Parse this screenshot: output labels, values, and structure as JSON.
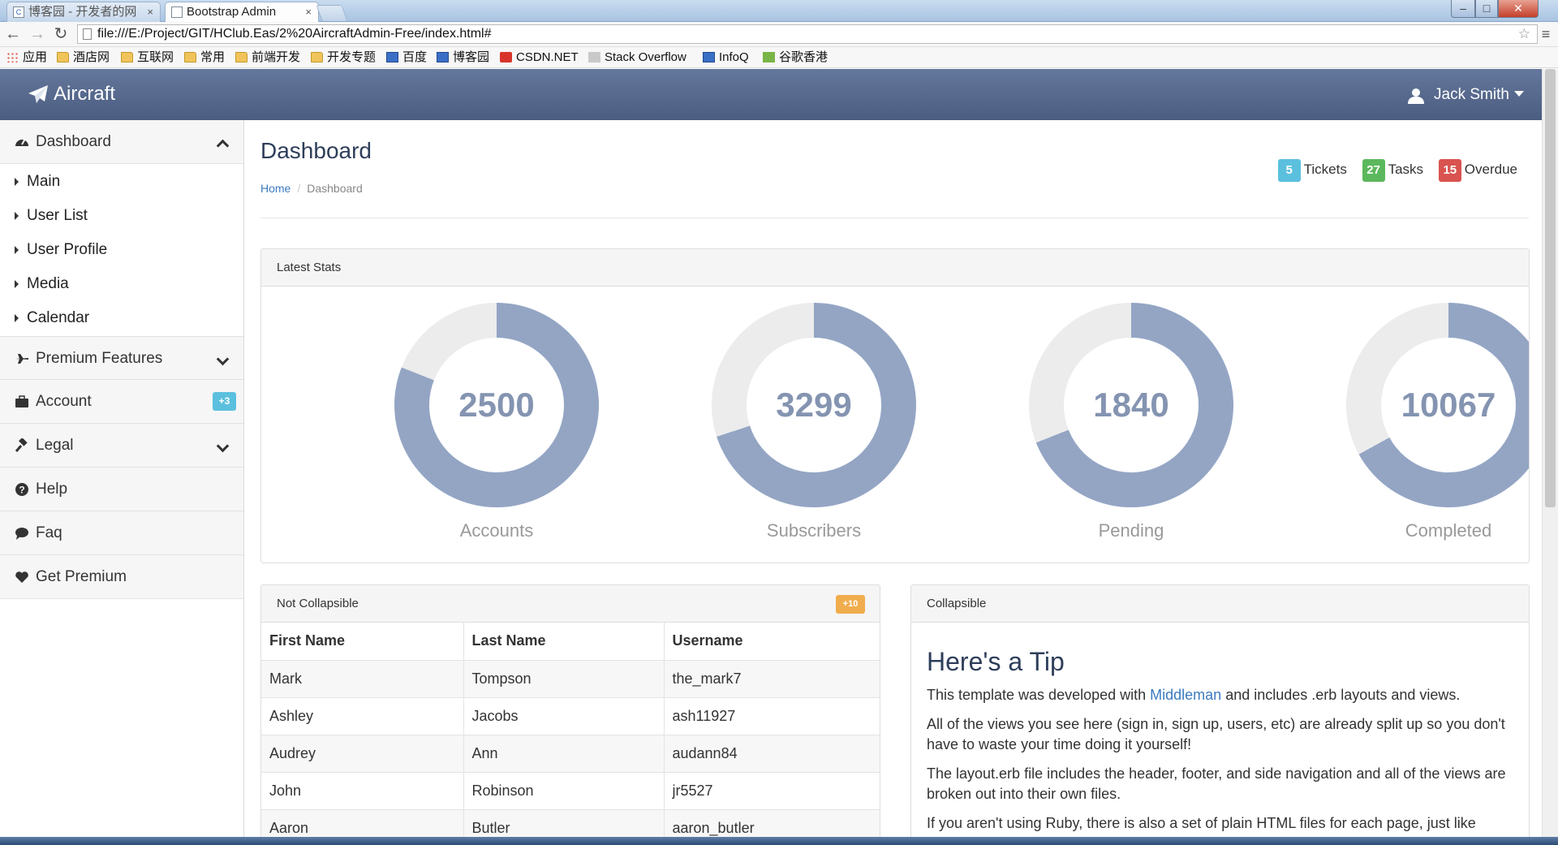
{
  "browser": {
    "tabs": [
      {
        "label": "博客园 - 开发者的网",
        "active": false
      },
      {
        "label": "Bootstrap Admin",
        "active": true
      }
    ],
    "url": "file:///E:/Project/GIT/HClub.Eas/2%20AircraftAdmin-Free/index.html#",
    "bookmarks": [
      "应用",
      "酒店网",
      "互联网",
      "常用",
      "前端开发",
      "开发专题",
      "百度",
      "博客园",
      "CSDN.NET",
      "Stack Overflow",
      "InfoQ",
      "谷歌香港"
    ]
  },
  "topnav": {
    "brand": "Aircraft",
    "user": "Jack Smith"
  },
  "sidebar": {
    "dashboard": "Dashboard",
    "sub_items": [
      "Main",
      "User List",
      "User Profile",
      "Media",
      "Calendar"
    ],
    "premium": "Premium Features",
    "account": "Account",
    "account_badge": "+3",
    "legal": "Legal",
    "help": "Help",
    "faq": "Faq",
    "get_premium": "Get Premium"
  },
  "header": {
    "title": "Dashboard",
    "breadcrumb_home": "Home",
    "breadcrumb_current": "Dashboard",
    "counters": [
      {
        "count": "5",
        "label": "Tickets",
        "color": "#5bc0de"
      },
      {
        "count": "27",
        "label": "Tasks",
        "color": "#5cb85c"
      },
      {
        "count": "15",
        "label": "Overdue",
        "color": "#d9534f"
      }
    ]
  },
  "stats": {
    "title": "Latest Stats",
    "fill_color": "#94a5c4",
    "track_color": "#ececec",
    "items": [
      {
        "value": "2500",
        "label": "Accounts",
        "fill_pct": 81
      },
      {
        "value": "3299",
        "label": "Subscribers",
        "fill_pct": 70
      },
      {
        "value": "1840",
        "label": "Pending",
        "fill_pct": 69
      },
      {
        "value": "10067",
        "label": "Completed",
        "fill_pct": 67
      }
    ]
  },
  "table_panel": {
    "title": "Not Collapsible",
    "badge": "+10",
    "columns": [
      "First Name",
      "Last Name",
      "Username"
    ],
    "rows": [
      [
        "Mark",
        "Tompson",
        "the_mark7"
      ],
      [
        "Ashley",
        "Jacobs",
        "ash11927"
      ],
      [
        "Audrey",
        "Ann",
        "audann84"
      ],
      [
        "John",
        "Robinson",
        "jr5527"
      ],
      [
        "Aaron",
        "Butler",
        "aaron_butler"
      ]
    ]
  },
  "tip_panel": {
    "title": "Collapsible",
    "heading": "Here's a Tip",
    "p1_before": "This template was developed with ",
    "p1_link": "Middleman",
    "p1_after": " and includes .erb layouts and views.",
    "p2": "All of the views you see here (sign in, sign up, users, etc) are already split up so you don't have to waste your time doing it yourself!",
    "p3": "The layout.erb file includes the header, footer, and side navigation and all of the views are broken out into their own files.",
    "p4": "If you aren't using Ruby, there is also a set of plain HTML files for each page, just like"
  }
}
